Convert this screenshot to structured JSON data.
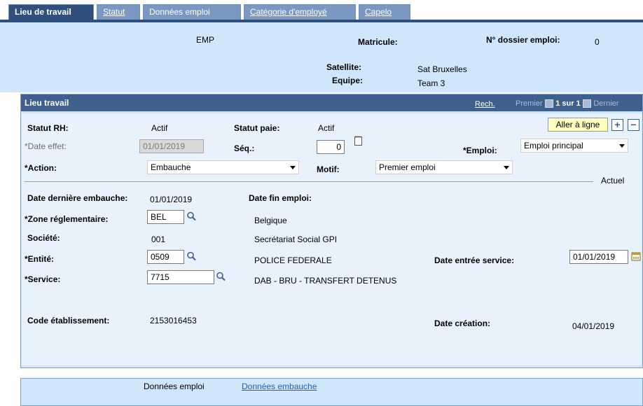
{
  "tabs": [
    {
      "label": "Lieu de travail",
      "active": true
    },
    {
      "label": "Statut",
      "active": false
    },
    {
      "label": "Données emploi",
      "active": false
    },
    {
      "label": "Catégorie d'employé",
      "active": false
    },
    {
      "label": "Capelo",
      "active": false
    }
  ],
  "header": {
    "emp_label": "EMP",
    "matricule_label": "Matricule:",
    "dossier_label": "N° dossier emploi:",
    "dossier_value": "0",
    "satellite_label": "Satellite:",
    "satellite_value": "Sat Bruxelles",
    "equipe_label": "Equipe:",
    "equipe_value": "Team 3"
  },
  "grid": {
    "title": "Lieu travail",
    "search_link": "Rech.",
    "first": "Premier",
    "count": "1 sur 1",
    "last": "Dernier"
  },
  "form": {
    "statut_rh_label": "Statut RH:",
    "statut_rh_value": "Actif",
    "statut_paie_label": "Statut paie:",
    "statut_paie_value": "Actif",
    "aller_ligne": "Aller à ligne",
    "add": "+",
    "remove": "−",
    "date_effet_label": "*Date effet:",
    "date_effet_value": "01/01/2019",
    "seq_label": "Séq.:",
    "seq_value": "0",
    "emploi_label": "*Emploi:",
    "emploi_value": "Emploi principal",
    "action_label": "*Action:",
    "action_value": "Embauche",
    "motif_label": "Motif:",
    "motif_value": "Premier emploi",
    "actuel": "Actuel",
    "date_derniere_label": "Date dernière embauche:",
    "date_derniere_value": "01/01/2019",
    "date_fin_label": "Date fin emploi:",
    "zone_label": "*Zone réglementaire:",
    "zone_value": "BEL",
    "zone_desc": "Belgique",
    "societe_label": "Société:",
    "societe_value": "001",
    "societe_desc": "Secrétariat Social GPI",
    "entite_label": "*Entité:",
    "entite_value": "0509",
    "entite_desc": "POLICE FEDERALE",
    "date_entree_label": "Date entrée service:",
    "date_entree_value": "01/01/2019",
    "service_label": "*Service:",
    "service_value": "7715",
    "service_desc": "DAB - BRU - TRANSFERT DETENUS",
    "code_label": "Code établissement:",
    "code_value": "2153016453",
    "date_creation_label": "Date création:",
    "date_creation_value": "04/01/2019"
  },
  "footer": {
    "donnees_emploi": "Données emploi",
    "donnees_embauche": "Données embauche"
  },
  "icons": {
    "lookup": "magnifier-icon",
    "calendar": "calendar-icon",
    "notepad": "note-icon"
  }
}
